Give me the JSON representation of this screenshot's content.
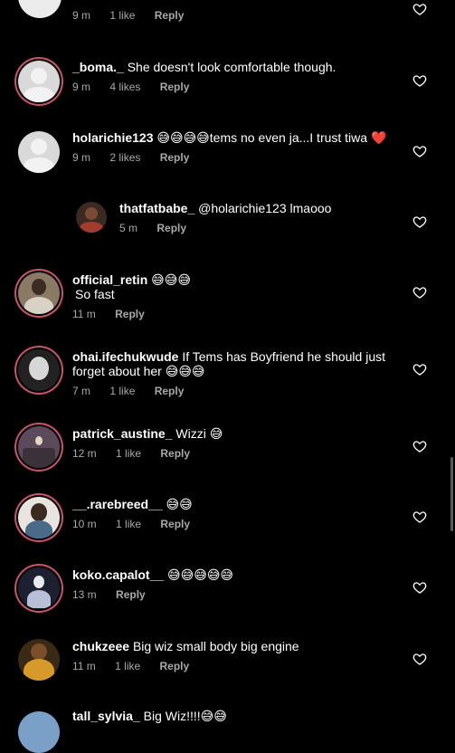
{
  "comments": [
    {
      "user": "",
      "text": "",
      "time": "9 m",
      "likes": "1 like",
      "reply": "Reply"
    },
    {
      "user": "_boma._",
      "text": "She doesn't look comfortable though.",
      "time": "9 m",
      "likes": "4 likes",
      "reply": "Reply"
    },
    {
      "user": "holarichie123",
      "text": "😅😅😅😅tems no even ja...I trust tiwa ❤️",
      "time": "9 m",
      "likes": "2 likes",
      "reply": "Reply"
    },
    {
      "user": "thatfatbabe_",
      "text": "@holarichie123 lmaooo",
      "time": "5 m",
      "likes": "",
      "reply": "Reply"
    },
    {
      "user": "official_retin",
      "text": "😅😅😅",
      "line2": "So fast",
      "time": "11 m",
      "likes": "",
      "reply": "Reply"
    },
    {
      "user": "ohai.ifechukwude",
      "text": "If Tems has Boyfriend he should just",
      "line2": "forget about her 😅😅😅",
      "time": "7 m",
      "likes": "1 like",
      "reply": "Reply"
    },
    {
      "user": "patrick_austine_",
      "text": "Wizzi 😅",
      "time": "12 m",
      "likes": "1 like",
      "reply": "Reply"
    },
    {
      "user": "__.rarebreed__",
      "text": "😅😅",
      "time": "10 m",
      "likes": "1 like",
      "reply": "Reply"
    },
    {
      "user": "koko.capalot__",
      "text": "😅😅😅😅😅",
      "time": "13 m",
      "likes": "",
      "reply": "Reply"
    },
    {
      "user": "chukzeee",
      "text": "Big wiz small body big engine",
      "time": "11 m",
      "likes": "1 like",
      "reply": "Reply"
    },
    {
      "user": "tall_sylvia_",
      "text": "Big Wiz!!!!😅😅",
      "time": "",
      "likes": "",
      "reply": ""
    }
  ],
  "icons": {
    "like": "heart-outline-icon"
  },
  "colors": {
    "story_ring": "#c8536a",
    "meta": "#a8a8a8",
    "background": "#000000"
  }
}
